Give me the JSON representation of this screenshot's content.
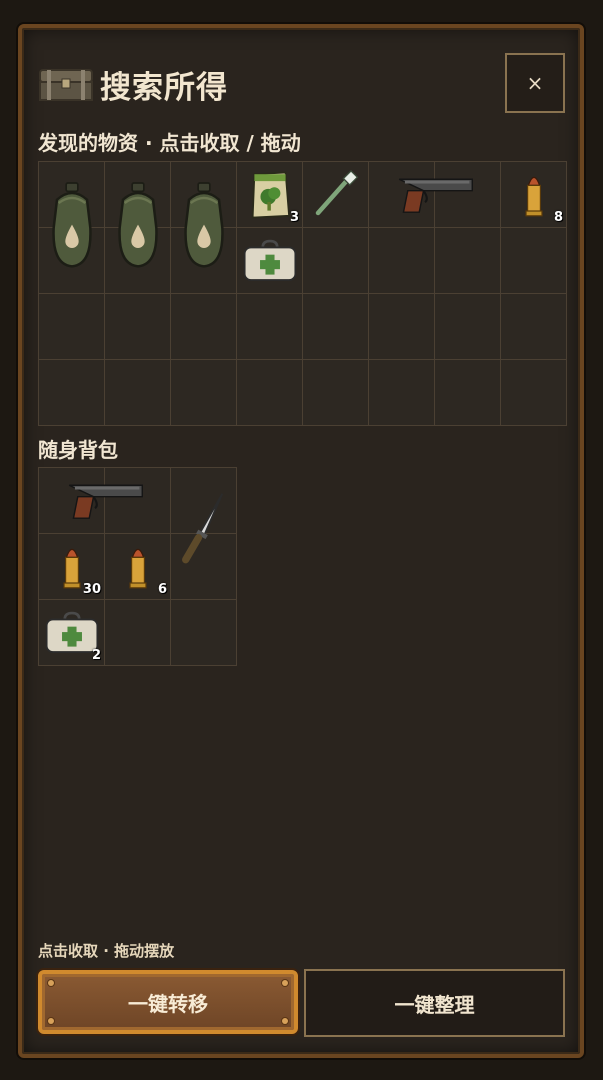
{
  "header": {
    "title": "搜索所得",
    "close_label": "×"
  },
  "found": {
    "label": "发现的物资 · 点击收取 / 拖动",
    "columns": 8,
    "rows": 4,
    "items": [
      {
        "name": "canteen",
        "icon": "canteen-icon",
        "col": 0,
        "row": 0,
        "w": 1,
        "h": 2
      },
      {
        "name": "canteen",
        "icon": "canteen-icon",
        "col": 1,
        "row": 0,
        "w": 1,
        "h": 2
      },
      {
        "name": "canteen",
        "icon": "canteen-icon",
        "col": 2,
        "row": 0,
        "w": 1,
        "h": 2
      },
      {
        "name": "vegetable-seeds",
        "icon": "seed-packet-icon",
        "col": 3,
        "row": 0,
        "w": 1,
        "h": 1,
        "qty": "3"
      },
      {
        "name": "toothbrush",
        "icon": "toothbrush-icon",
        "col": 4,
        "row": 0,
        "w": 1,
        "h": 1
      },
      {
        "name": "pistol",
        "icon": "pistol-icon",
        "col": 5,
        "row": 0,
        "w": 2,
        "h": 1
      },
      {
        "name": "bullet",
        "icon": "bullet-icon",
        "col": 7,
        "row": 0,
        "w": 1,
        "h": 1,
        "qty": "8"
      },
      {
        "name": "first-aid-kit",
        "icon": "first-aid-kit-icon",
        "col": 3,
        "row": 1,
        "w": 1,
        "h": 1
      }
    ]
  },
  "backpack": {
    "label": "随身背包",
    "columns": 3,
    "rows": 3,
    "items": [
      {
        "name": "pistol",
        "icon": "pistol-icon",
        "col": 0,
        "row": 0,
        "w": 2,
        "h": 1
      },
      {
        "name": "knife",
        "icon": "knife-icon",
        "col": 2,
        "row": 0,
        "w": 1,
        "h": 2
      },
      {
        "name": "bullet",
        "icon": "bullet-icon",
        "col": 0,
        "row": 1,
        "w": 1,
        "h": 1,
        "qty": "30"
      },
      {
        "name": "bullet",
        "icon": "bullet-icon",
        "col": 1,
        "row": 1,
        "w": 1,
        "h": 1,
        "qty": "6"
      },
      {
        "name": "first-aid-kit",
        "icon": "first-aid-kit-icon",
        "col": 0,
        "row": 2,
        "w": 1,
        "h": 1,
        "qty": "2"
      }
    ]
  },
  "footer": {
    "hint": "点击收取 · 拖动摆放",
    "transfer_label": "一键转移",
    "sort_label": "一键整理"
  }
}
